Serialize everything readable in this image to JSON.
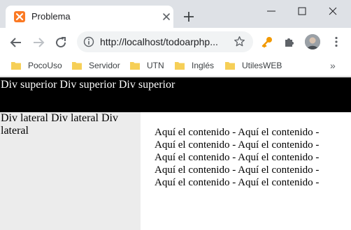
{
  "browser": {
    "tab_title": "Problema",
    "url": "http://localhost/todoarphp...",
    "bookmarks": [
      {
        "label": "PocoUso"
      },
      {
        "label": "Servidor"
      },
      {
        "label": "UTN"
      },
      {
        "label": "Inglés"
      },
      {
        "label": "UtilesWEB"
      }
    ],
    "bookmarks_overflow": "»",
    "colors": {
      "titlebar": "#dee1e6",
      "omnibox": "#f1f3f4",
      "favicon": "#fb7a24",
      "folder": "#f6cf57",
      "extension_key": "#f29900"
    }
  },
  "page": {
    "superior": "Div superior Div superior Div superior",
    "lateral": "Div lateral Div lateral Div lateral",
    "contenido": [
      "Aquí el contenido - Aquí el contenido -",
      "Aquí el contenido - Aquí el contenido -",
      "Aquí el contenido - Aquí el contenido -",
      "Aquí el contenido - Aquí el contenido -",
      "Aquí el contenido - Aquí el contenido -"
    ],
    "colors": {
      "superior_bg": "#000000",
      "superior_text": "#ffffff",
      "lateral_bg": "#ececec"
    }
  }
}
